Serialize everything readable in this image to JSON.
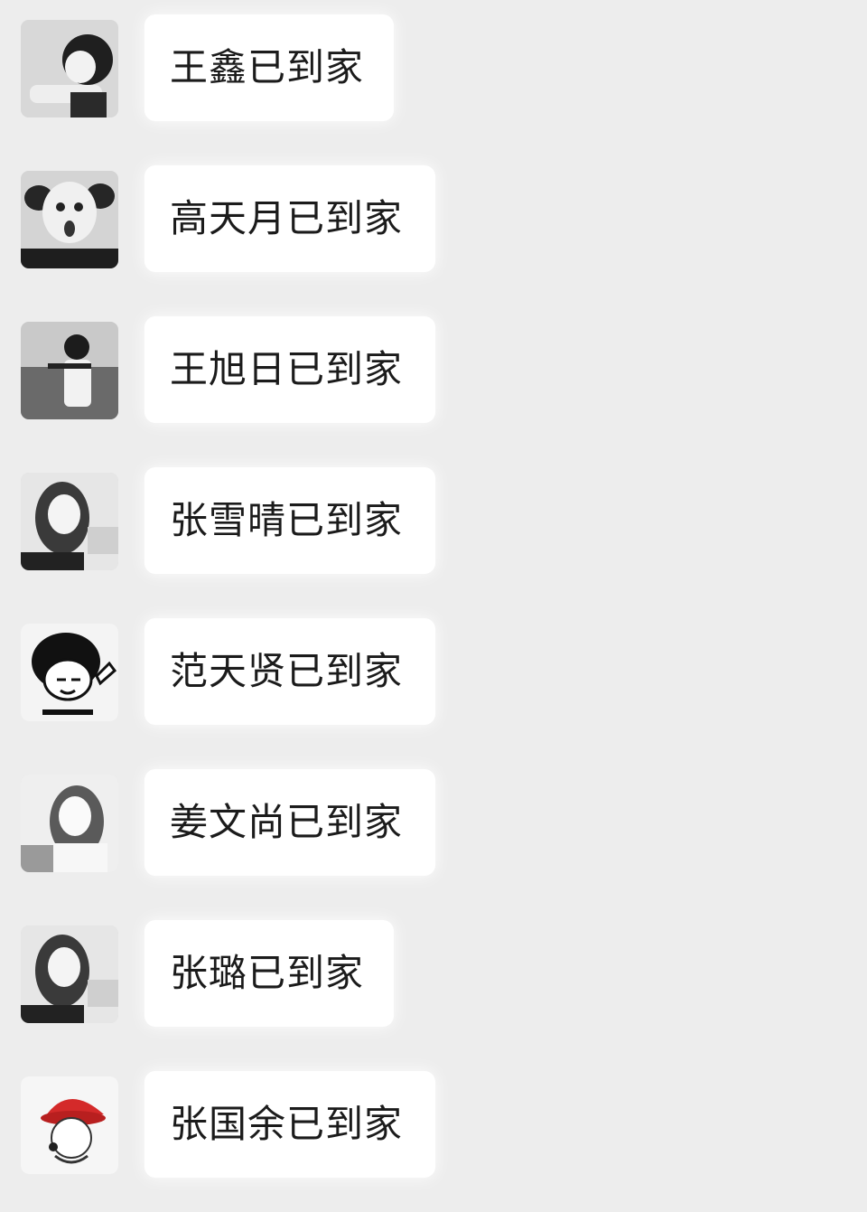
{
  "messages": [
    {
      "sender": "王鑫",
      "text": "王鑫已到家",
      "avatar": "boy-photo-avatar"
    },
    {
      "sender": "高天月",
      "text": "高天月已到家",
      "avatar": "child-photo-avatar"
    },
    {
      "sender": "王旭日",
      "text": "王旭日已到家",
      "avatar": "boy-seaside-avatar"
    },
    {
      "sender": "张雪晴",
      "text": "张雪晴已到家",
      "avatar": "girl-photo-avatar"
    },
    {
      "sender": "范天贤",
      "text": "范天贤已到家",
      "avatar": "meme-cartoon-avatar"
    },
    {
      "sender": "姜文尚",
      "text": "姜文尚已到家",
      "avatar": "girl-bright-photo-avatar"
    },
    {
      "sender": "张璐",
      "text": "张璐已到家",
      "avatar": "girl-photo-avatar"
    },
    {
      "sender": "张国余",
      "text": "张国余已到家",
      "avatar": "red-hat-cartoon-avatar"
    }
  ],
  "colors": {
    "background": "#ededed",
    "bubble": "#ffffff",
    "text": "#1b1b1b"
  }
}
